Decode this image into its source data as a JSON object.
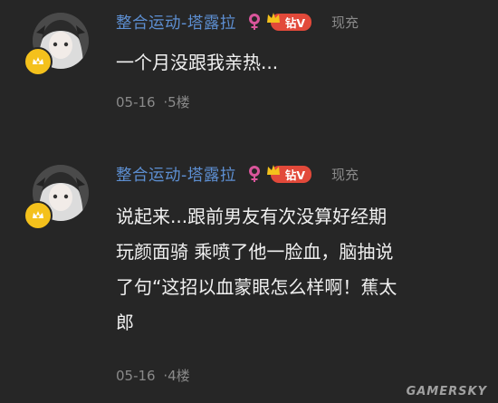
{
  "comments": [
    {
      "username": "整合运动-塔露拉",
      "vip_badge": "钻V",
      "reply_label": "现充",
      "text": "一个月没跟我亲热...",
      "date": "05-16",
      "floor": "·5楼"
    },
    {
      "username": "整合运动-塔露拉",
      "vip_badge": "钻V",
      "reply_label": "现充",
      "text": "说起来...跟前男友有次没算好经期\n玩颜面骑 乘喷了他一脸血，脑抽说\n了句“这招以血蒙眼怎么样啊！蕉太\n郎",
      "date": "05-16",
      "floor": "·4楼"
    }
  ],
  "watermark": "GAMERSKY",
  "colors": {
    "background": "#262626",
    "username": "#5d8fd2",
    "gender": "#d9559b",
    "vip": "#e2493a",
    "level_badge": "#f4c11c"
  },
  "icons": [
    "avatar",
    "level-badge-icon",
    "female-icon",
    "crown-icon"
  ]
}
